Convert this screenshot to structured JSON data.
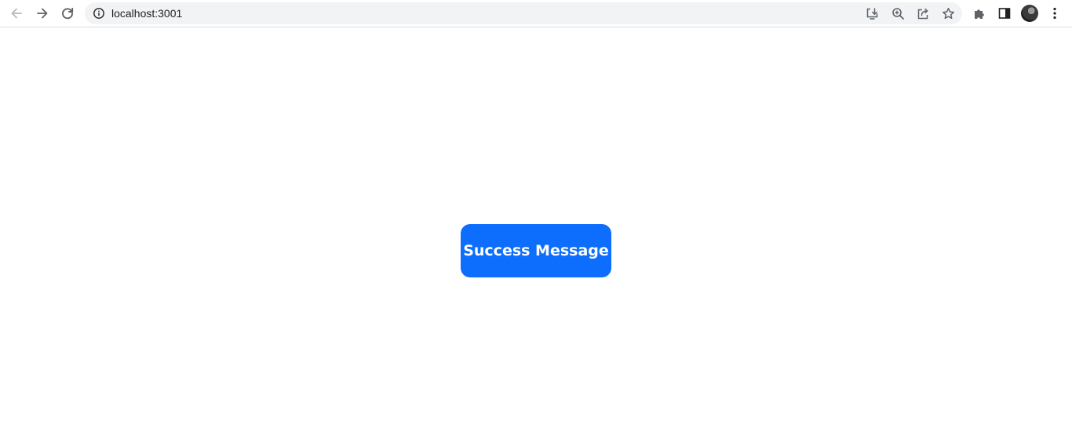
{
  "browser": {
    "url": "localhost:3001",
    "icons": {
      "back": "arrow-left-icon",
      "forward": "arrow-right-icon",
      "reload": "reload-icon",
      "site_info": "info-icon",
      "install": "install-app-icon",
      "zoom": "zoom-icon",
      "share": "share-icon",
      "bookmark": "star-icon",
      "extensions": "puzzle-icon",
      "side_panel": "side-panel-icon",
      "menu": "kebab-menu-icon"
    }
  },
  "main": {
    "button_label": "Success Message",
    "button_color": "#0d6efd"
  }
}
